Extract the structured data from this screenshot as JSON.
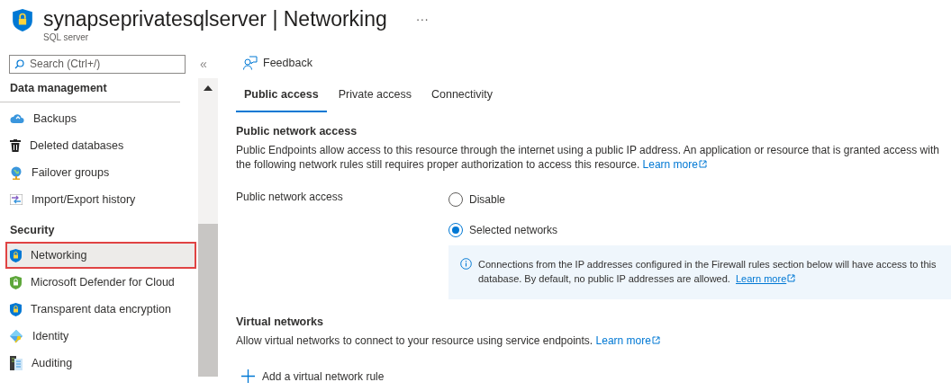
{
  "header": {
    "title": "synapseprivatesqlserver | Networking",
    "subtitle": "SQL server",
    "more": "···"
  },
  "sidebar": {
    "search": {
      "placeholder": "Search (Ctrl+/)"
    },
    "collapse": "«",
    "groups": [
      {
        "title": "Data management",
        "items": [
          {
            "label": "Backups",
            "kind": "cloud",
            "selected": false
          },
          {
            "label": "Deleted databases",
            "kind": "trash",
            "selected": false
          },
          {
            "label": "Failover groups",
            "kind": "globe",
            "selected": false
          },
          {
            "label": "Import/Export history",
            "kind": "transfer",
            "selected": false
          }
        ]
      },
      {
        "title": "Security",
        "items": [
          {
            "label": "Networking",
            "kind": "shield",
            "selected": true
          },
          {
            "label": "Microsoft Defender for Cloud",
            "kind": "shield-green",
            "selected": false
          },
          {
            "label": "Transparent data encryption",
            "kind": "shield",
            "selected": false
          },
          {
            "label": "Identity",
            "kind": "identity",
            "selected": false
          },
          {
            "label": "Auditing",
            "kind": "audit",
            "selected": false
          }
        ]
      }
    ]
  },
  "toolbar": {
    "feedback": "Feedback"
  },
  "tabs": [
    {
      "label": "Public access",
      "selected": true
    },
    {
      "label": "Private access",
      "selected": false
    },
    {
      "label": "Connectivity",
      "selected": false
    }
  ],
  "public_network": {
    "heading": "Public network access",
    "description": "Public Endpoints allow access to this resource through the internet using a public IP address. An application or resource that is granted access with the following network rules still requires proper authorization to access this resource.",
    "link": "Learn more",
    "field_label": "Public network access",
    "options": [
      {
        "label": "Disable",
        "selected": false
      },
      {
        "label": "Selected networks",
        "selected": true
      }
    ],
    "info": {
      "text": "Connections from the IP addresses configured in the Firewall rules section below will have access to this database. By default, no public IP addresses are allowed.",
      "link": "Learn more"
    }
  },
  "virtual_networks": {
    "heading": "Virtual networks",
    "description": "Allow virtual networks to connect to your resource using service endpoints.",
    "link": "Learn more",
    "add": "Add a virtual network rule"
  }
}
